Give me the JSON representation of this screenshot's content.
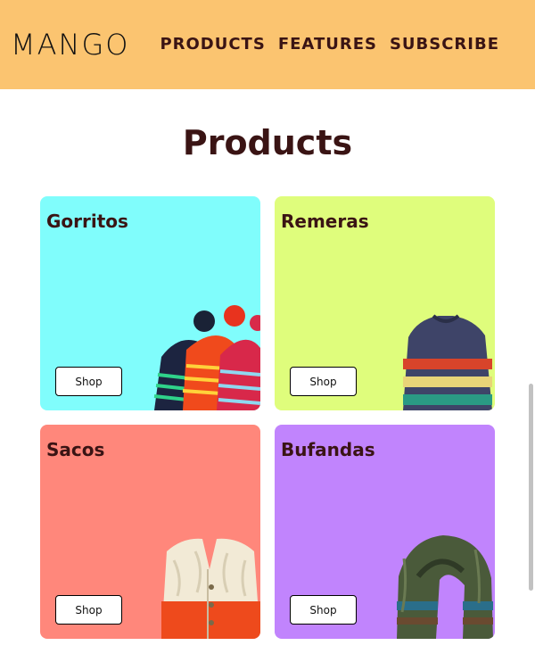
{
  "header": {
    "logo": "MANGO",
    "nav": [
      "PRODUCTS",
      "FEATURES",
      "SUBSCRIBE"
    ],
    "background": "#fbc470"
  },
  "main": {
    "title": "Products",
    "products": [
      {
        "name": "Gorritos",
        "button": "Shop",
        "color": "#80fdfc",
        "image_icon": "beanies-image"
      },
      {
        "name": "Remeras",
        "button": "Shop",
        "color": "#dffd7c",
        "image_icon": "sweater-image"
      },
      {
        "name": "Sacos",
        "button": "Shop",
        "color": "#ff877b",
        "image_icon": "cardigan-image"
      },
      {
        "name": "Bufandas",
        "button": "Shop",
        "color": "#c184fd",
        "image_icon": "scarf-image"
      }
    ]
  }
}
